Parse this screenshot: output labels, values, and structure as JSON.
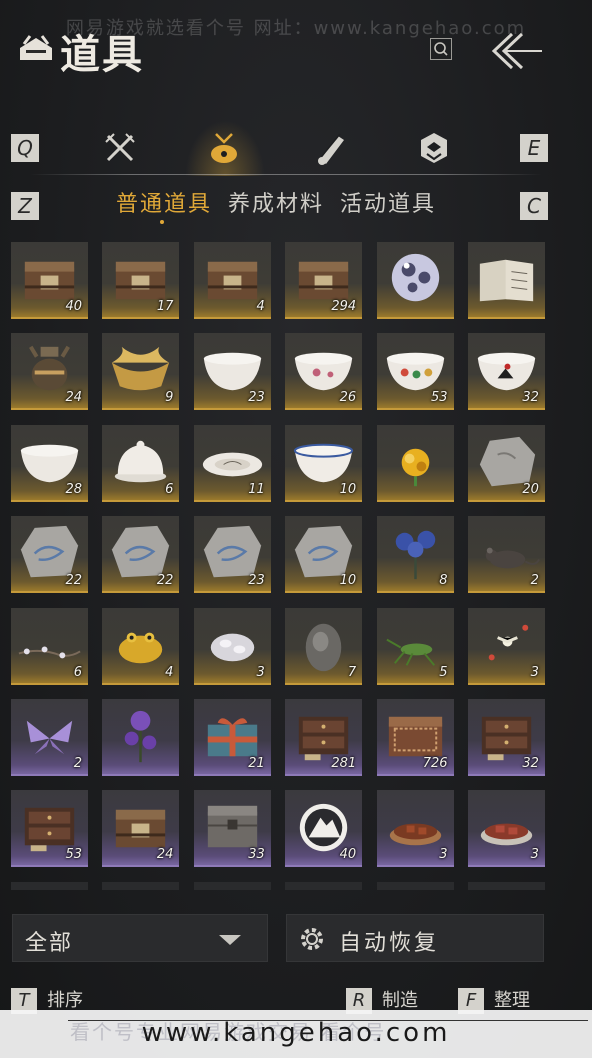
{
  "watermark_top": "网易游戏就选看个号  网址：www.kangehao.com",
  "header": {
    "title": "道具"
  },
  "category_keys": {
    "prev": "Q",
    "next": "E"
  },
  "category_tabs": [
    {
      "icon": "crossed-swords-icon",
      "active": false
    },
    {
      "icon": "bundle-bag-icon",
      "active": true
    },
    {
      "icon": "scroll-icon",
      "active": false
    },
    {
      "icon": "gem-badge-icon",
      "active": false
    }
  ],
  "sub_keys": {
    "prev": "Z",
    "next": "C"
  },
  "sub_tabs": [
    {
      "label": "普通道具",
      "active": true
    },
    {
      "label": "养成材料",
      "active": false
    },
    {
      "label": "活动道具",
      "active": false
    }
  ],
  "items": [
    {
      "icon": "treasure-chest-icon",
      "qty": "40",
      "rarity": "gold"
    },
    {
      "icon": "treasure-chest-icon",
      "qty": "17",
      "rarity": "gold"
    },
    {
      "icon": "treasure-chest-icon",
      "qty": "4",
      "rarity": "gold"
    },
    {
      "icon": "treasure-chest-icon",
      "qty": "294",
      "rarity": "gold"
    },
    {
      "icon": "crystal-orb-icon",
      "qty": "",
      "rarity": "gold"
    },
    {
      "icon": "book-icon",
      "qty": "",
      "rarity": "gold"
    },
    {
      "icon": "incense-burner-icon",
      "qty": "24",
      "rarity": "gold"
    },
    {
      "icon": "gold-ingot-icon",
      "qty": "9",
      "rarity": "gold"
    },
    {
      "icon": "porcelain-bowl-icon",
      "qty": "23",
      "rarity": "gold"
    },
    {
      "icon": "painted-bowl-icon",
      "qty": "26",
      "rarity": "gold"
    },
    {
      "icon": "floral-bowl-icon",
      "qty": "53",
      "rarity": "gold"
    },
    {
      "icon": "rooster-bowl-icon",
      "qty": "32",
      "rarity": "gold"
    },
    {
      "icon": "white-bowl-icon",
      "qty": "28",
      "rarity": "gold"
    },
    {
      "icon": "covered-bowl-icon",
      "qty": "6",
      "rarity": "gold"
    },
    {
      "icon": "plate-icon",
      "qty": "11",
      "rarity": "gold"
    },
    {
      "icon": "blue-rim-bowl-icon",
      "qty": "10",
      "rarity": "gold"
    },
    {
      "icon": "golden-flower-icon",
      "qty": "",
      "rarity": "gold"
    },
    {
      "icon": "stone-icon",
      "qty": "20",
      "rarity": "gold"
    },
    {
      "icon": "fossil-stone-icon",
      "qty": "22",
      "rarity": "gold"
    },
    {
      "icon": "fossil-stone-icon",
      "qty": "22",
      "rarity": "gold"
    },
    {
      "icon": "fossil-stone-icon",
      "qty": "23",
      "rarity": "gold"
    },
    {
      "icon": "fossil-stone-icon",
      "qty": "10",
      "rarity": "gold"
    },
    {
      "icon": "blue-flower-icon",
      "qty": "8",
      "rarity": "gold"
    },
    {
      "icon": "rat-icon",
      "qty": "2",
      "rarity": "gold"
    },
    {
      "icon": "flower-branch-icon",
      "qty": "6",
      "rarity": "gold"
    },
    {
      "icon": "golden-toad-icon",
      "qty": "4",
      "rarity": "gold"
    },
    {
      "icon": "silk-cocoon-icon",
      "qty": "3",
      "rarity": "gold"
    },
    {
      "icon": "grey-stone-icon",
      "qty": "7",
      "rarity": "gold"
    },
    {
      "icon": "cricket-icon",
      "qty": "5",
      "rarity": "gold"
    },
    {
      "icon": "firefly-icon",
      "qty": "3",
      "rarity": "gold"
    },
    {
      "icon": "butterfly-icon",
      "qty": "2",
      "rarity": "purple"
    },
    {
      "icon": "purple-flower-icon",
      "qty": "",
      "rarity": "purple"
    },
    {
      "icon": "gift-box-icon",
      "qty": "21",
      "rarity": "purple"
    },
    {
      "icon": "wooden-chest-icon",
      "qty": "281",
      "rarity": "purple"
    },
    {
      "icon": "carved-chest-icon",
      "qty": "726",
      "rarity": "purple"
    },
    {
      "icon": "wooden-chest-icon",
      "qty": "32",
      "rarity": "purple"
    },
    {
      "icon": "wooden-chest-icon",
      "qty": "53",
      "rarity": "purple"
    },
    {
      "icon": "treasure-chest-icon",
      "qty": "24",
      "rarity": "purple"
    },
    {
      "icon": "iron-chest-icon",
      "qty": "33",
      "rarity": "purple"
    },
    {
      "icon": "mountain-emblem-icon",
      "qty": "40",
      "rarity": "purple"
    },
    {
      "icon": "braised-dish-icon",
      "qty": "3",
      "rarity": "purple"
    },
    {
      "icon": "meat-dish-icon",
      "qty": "3",
      "rarity": "purple"
    },
    {
      "icon": "partial-icon",
      "qty": "",
      "rarity": "none"
    },
    {
      "icon": "partial-icon",
      "qty": "",
      "rarity": "none"
    },
    {
      "icon": "partial-icon",
      "qty": "",
      "rarity": "none"
    },
    {
      "icon": "partial-icon",
      "qty": "",
      "rarity": "none"
    },
    {
      "icon": "partial-icon",
      "qty": "",
      "rarity": "none"
    },
    {
      "icon": "partial-icon",
      "qty": "",
      "rarity": "none"
    }
  ],
  "bottom": {
    "filter_label": "全部",
    "auto_restore_label": "自动恢复",
    "sort": {
      "key": "T",
      "label": "排序"
    },
    "craft": {
      "key": "R",
      "label": "制造"
    },
    "organize": {
      "key": "F",
      "label": "整理"
    }
  },
  "footer": {
    "url": "www.kangehao.com",
    "faint_text": "看个号专业网易游戏交易   看个号"
  },
  "colors": {
    "gold_accent": "#e0a838",
    "gold_rarity": "#c59a3a",
    "purple_rarity": "#8e7ab8"
  }
}
